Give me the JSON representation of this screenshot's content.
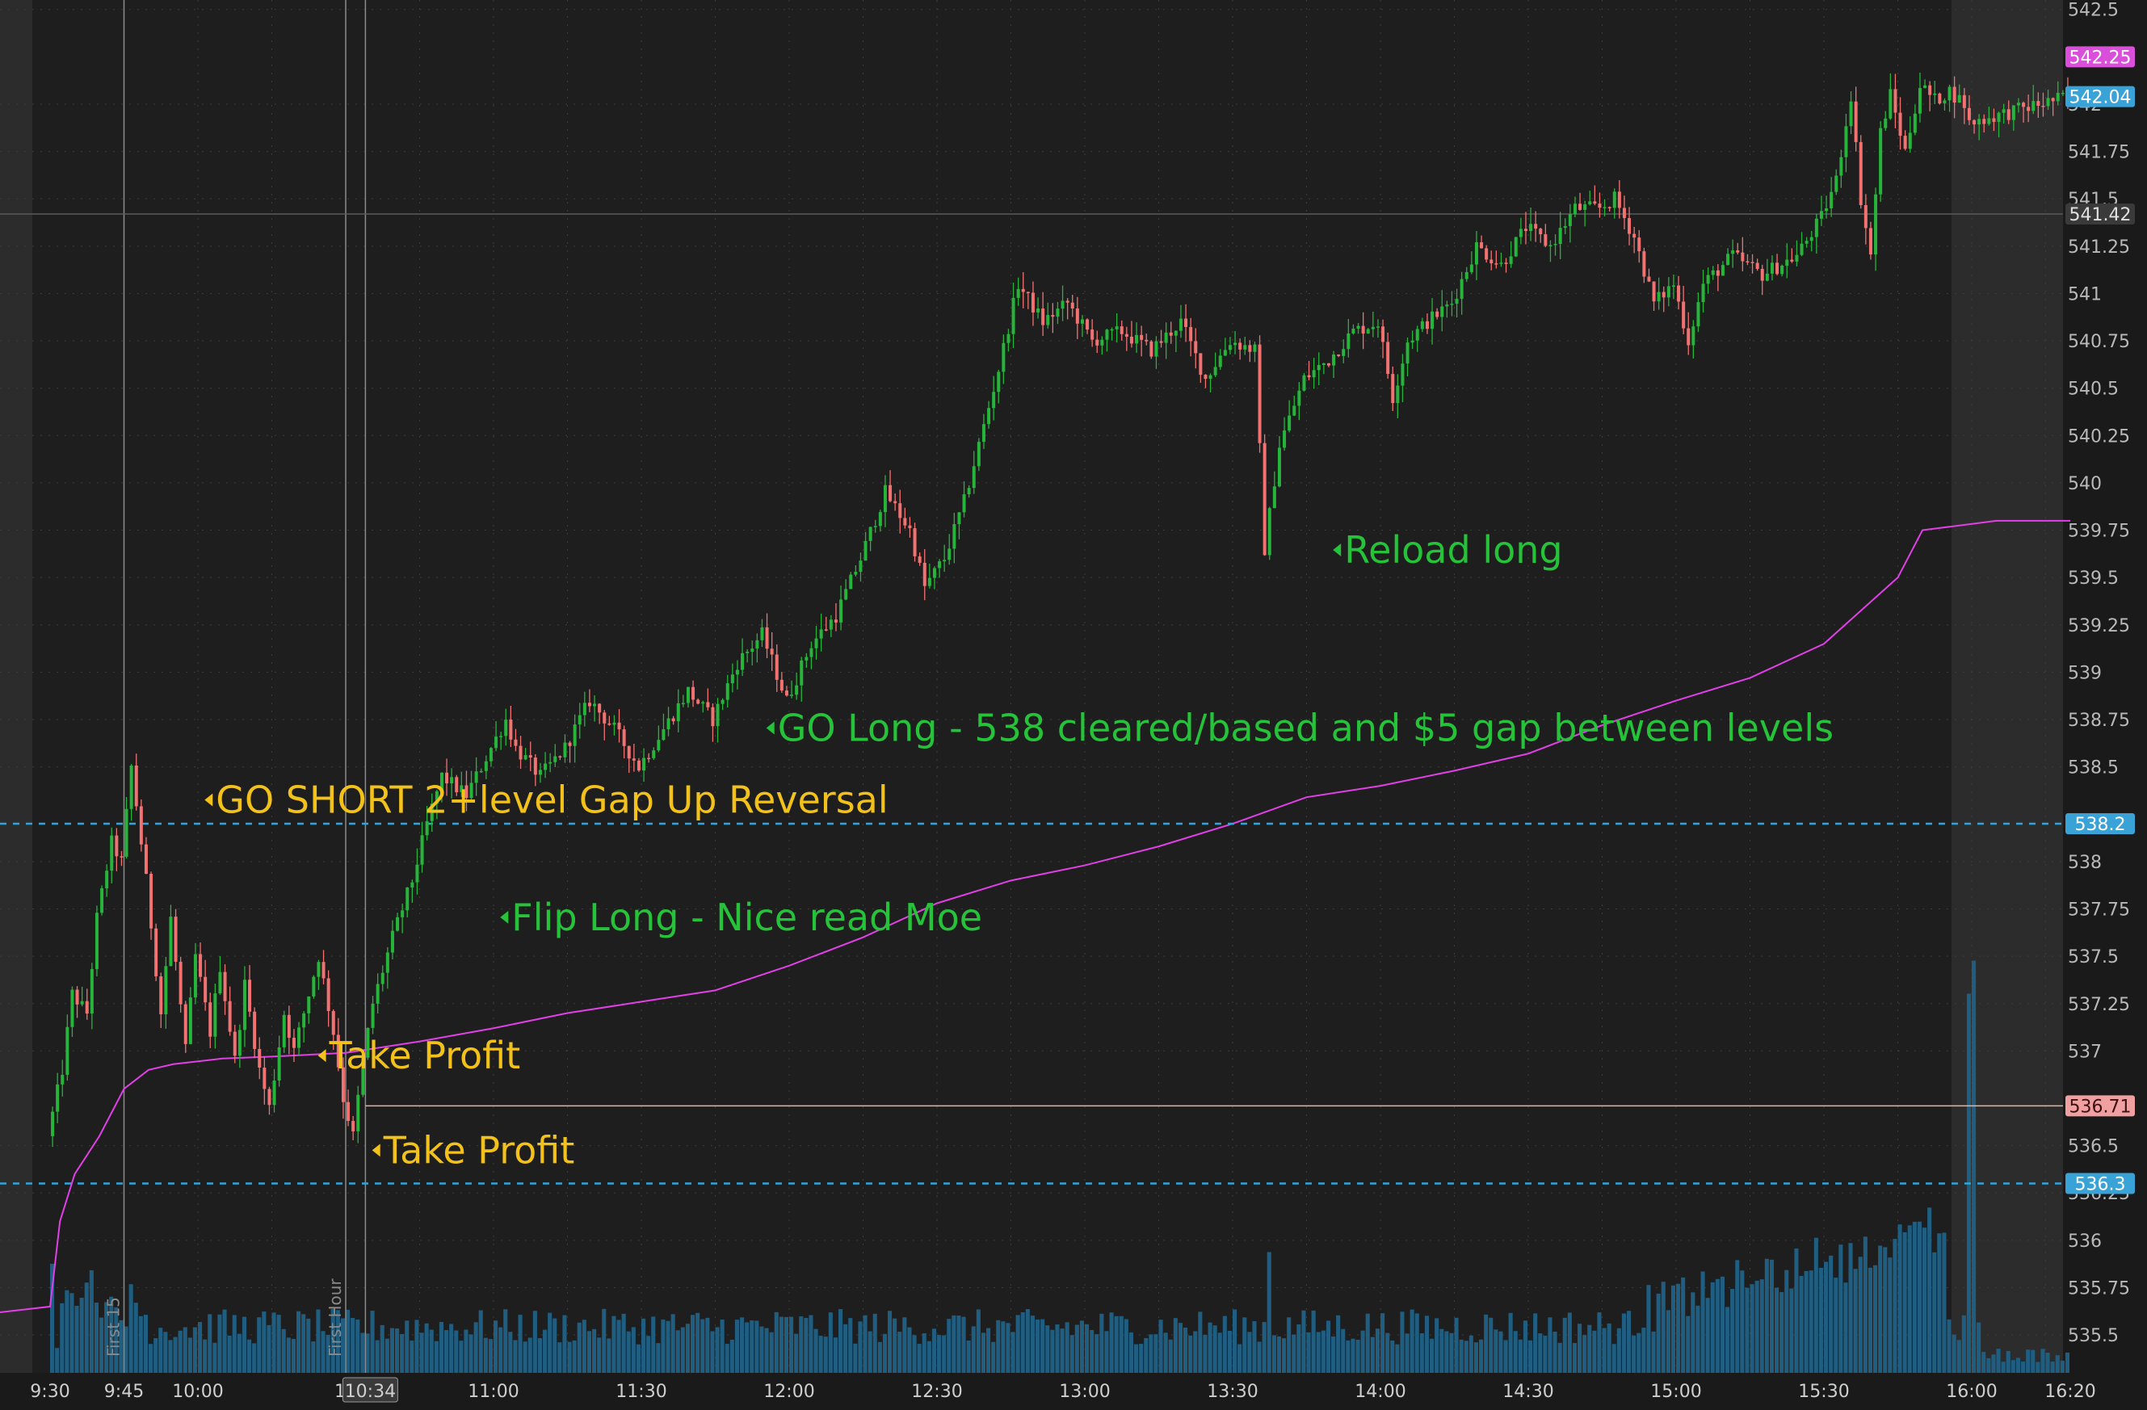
{
  "chart_data": {
    "type": "candlestick",
    "y_axis": {
      "range": [
        535.3,
        542.55
      ],
      "ticks": [
        "542.5",
        "542",
        "541.75",
        "541.5",
        "541.25",
        "541",
        "540.75",
        "540.5",
        "540.25",
        "540",
        "539.75",
        "539.5",
        "539.25",
        "539",
        "538.75",
        "538.5",
        "538",
        "537.75",
        "537.5",
        "537.25",
        "537",
        "536.5",
        "536.25",
        "536",
        "535.75",
        "535.5"
      ]
    },
    "x_axis": {
      "session_range": [
        "9:30",
        "16:20"
      ],
      "ticks": [
        "9:30",
        "9:45",
        "10:00",
        "10",
        "11:00",
        "11:30",
        "12:00",
        "12:30",
        "13:00",
        "13:30",
        "14:00",
        "14:30",
        "15:00",
        "15:30",
        "16:00",
        "16:20"
      ],
      "crosshair_label": "10:34"
    },
    "price_path": [
      [
        "9:30",
        536.55
      ],
      [
        "9:33",
        536.9
      ],
      [
        "9:35",
        537.3
      ],
      [
        "9:38",
        537.2
      ],
      [
        "9:40",
        537.7
      ],
      [
        "9:43",
        538.1
      ],
      [
        "9:45",
        538.0
      ],
      [
        "9:47",
        538.5
      ],
      [
        "9:50",
        537.9
      ],
      [
        "9:53",
        537.2
      ],
      [
        "9:55",
        537.7
      ],
      [
        "9:58",
        537.0
      ],
      [
        "10:00",
        537.5
      ],
      [
        "10:03",
        537.1
      ],
      [
        "10:05",
        537.45
      ],
      [
        "10:08",
        536.95
      ],
      [
        "10:10",
        537.35
      ],
      [
        "10:13",
        536.9
      ],
      [
        "10:15",
        536.7
      ],
      [
        "10:18",
        537.2
      ],
      [
        "10:20",
        537.0
      ],
      [
        "10:23",
        537.3
      ],
      [
        "10:25",
        537.5
      ],
      [
        "10:28",
        537.1
      ],
      [
        "10:30",
        536.75
      ],
      [
        "10:32",
        536.55
      ],
      [
        "10:34",
        536.95
      ],
      [
        "10:36",
        537.25
      ],
      [
        "10:40",
        537.6
      ],
      [
        "10:44",
        537.9
      ],
      [
        "10:47",
        538.2
      ],
      [
        "10:50",
        538.45
      ],
      [
        "10:55",
        538.35
      ],
      [
        "11:00",
        538.6
      ],
      [
        "11:03",
        538.75
      ],
      [
        "11:05",
        538.6
      ],
      [
        "11:10",
        538.45
      ],
      [
        "11:15",
        538.6
      ],
      [
        "11:20",
        538.85
      ],
      [
        "11:25",
        538.7
      ],
      [
        "11:30",
        538.5
      ],
      [
        "11:35",
        538.7
      ],
      [
        "11:40",
        538.9
      ],
      [
        "11:45",
        538.75
      ],
      [
        "11:50",
        539.05
      ],
      [
        "11:55",
        539.2
      ],
      [
        "12:00",
        538.85
      ],
      [
        "12:05",
        539.15
      ],
      [
        "12:10",
        539.3
      ],
      [
        "12:15",
        539.6
      ],
      [
        "12:20",
        539.95
      ],
      [
        "12:25",
        539.75
      ],
      [
        "12:28",
        539.45
      ],
      [
        "12:32",
        539.6
      ],
      [
        "12:36",
        539.9
      ],
      [
        "12:40",
        540.3
      ],
      [
        "12:43",
        540.6
      ],
      [
        "12:47",
        541.05
      ],
      [
        "12:52",
        540.85
      ],
      [
        "12:57",
        540.95
      ],
      [
        "13:02",
        540.75
      ],
      [
        "13:08",
        540.8
      ],
      [
        "13:14",
        540.7
      ],
      [
        "13:20",
        540.85
      ],
      [
        "13:25",
        540.55
      ],
      [
        "13:30",
        540.75
      ],
      [
        "13:35",
        540.7
      ],
      [
        "13:37",
        539.65
      ],
      [
        "13:40",
        540.2
      ],
      [
        "13:45",
        540.55
      ],
      [
        "13:50",
        540.65
      ],
      [
        "13:55",
        540.8
      ],
      [
        "14:00",
        540.85
      ],
      [
        "14:03",
        540.45
      ],
      [
        "14:06",
        540.75
      ],
      [
        "14:10",
        540.85
      ],
      [
        "14:15",
        540.95
      ],
      [
        "14:20",
        541.25
      ],
      [
        "14:25",
        541.15
      ],
      [
        "14:30",
        541.35
      ],
      [
        "14:35",
        541.25
      ],
      [
        "14:40",
        541.45
      ],
      [
        "14:45",
        541.45
      ],
      [
        "14:48",
        541.5
      ],
      [
        "14:52",
        541.3
      ],
      [
        "14:56",
        540.95
      ],
      [
        "15:00",
        541.05
      ],
      [
        "15:03",
        540.75
      ],
      [
        "15:06",
        541.05
      ],
      [
        "15:12",
        541.2
      ],
      [
        "15:18",
        541.1
      ],
      [
        "15:25",
        541.2
      ],
      [
        "15:30",
        541.4
      ],
      [
        "15:33",
        541.6
      ],
      [
        "15:36",
        542.05
      ],
      [
        "15:38",
        541.5
      ],
      [
        "15:40",
        541.2
      ],
      [
        "15:42",
        541.85
      ],
      [
        "15:44",
        542.05
      ],
      [
        "15:47",
        541.75
      ],
      [
        "15:50",
        542.1
      ],
      [
        "15:53",
        542.02
      ],
      [
        "15:56",
        542.07
      ],
      [
        "15:59",
        542.0
      ],
      [
        "16:00",
        541.9
      ],
      [
        "16:20",
        542.04
      ]
    ],
    "vwap": [
      [
        "9:30",
        535.65
      ],
      [
        "9:32",
        536.1
      ],
      [
        "9:35",
        536.35
      ],
      [
        "9:40",
        536.55
      ],
      [
        "9:45",
        536.8
      ],
      [
        "9:50",
        536.9
      ],
      [
        "9:55",
        536.93
      ],
      [
        "10:05",
        536.96
      ],
      [
        "10:15",
        536.97
      ],
      [
        "10:30",
        536.99
      ],
      [
        "10:45",
        537.05
      ],
      [
        "11:00",
        537.12
      ],
      [
        "11:15",
        537.2
      ],
      [
        "11:30",
        537.26
      ],
      [
        "11:45",
        537.32
      ],
      [
        "12:00",
        537.45
      ],
      [
        "12:15",
        537.6
      ],
      [
        "12:30",
        537.78
      ],
      [
        "12:45",
        537.9
      ],
      [
        "13:00",
        537.98
      ],
      [
        "13:15",
        538.08
      ],
      [
        "13:30",
        538.2
      ],
      [
        "13:45",
        538.34
      ],
      [
        "14:00",
        538.4
      ],
      [
        "14:15",
        538.48
      ],
      [
        "14:30",
        538.57
      ],
      [
        "14:45",
        538.72
      ],
      [
        "15:00",
        538.85
      ],
      [
        "15:15",
        538.97
      ],
      [
        "15:30",
        539.15
      ],
      [
        "15:45",
        539.5
      ],
      [
        "15:50",
        539.75
      ],
      [
        "16:05",
        539.8
      ],
      [
        "16:20",
        539.8
      ]
    ],
    "volume_profile": {
      "open_spike": 0.35,
      "midday_spike_13:37": 0.55,
      "close_spike": 0.92,
      "close_peak": 1.0
    },
    "price_badges": [
      {
        "label": "542.25",
        "value": 542.25,
        "bg": "#d94fd9",
        "fg": "#ffffff"
      },
      {
        "label": "542.04",
        "value": 542.04,
        "bg": "#39a3d8",
        "fg": "#ffffff"
      },
      {
        "label": "541.42",
        "value": 541.42,
        "bg": "#3a3a3a",
        "fg": "#e0e0e0"
      },
      {
        "label": "538.2",
        "value": 538.2,
        "bg": "#39a3d8",
        "fg": "#ffffff"
      },
      {
        "label": "536.71",
        "value": 536.71,
        "bg": "#f0a0a0",
        "fg": "#3a1010"
      },
      {
        "label": "536.3",
        "value": 536.3,
        "bg": "#39a3d8",
        "fg": "#ffffff"
      }
    ],
    "levels": [
      {
        "value": 538.2,
        "style": "dashed",
        "color": "#2ea8dc"
      },
      {
        "value": 536.3,
        "style": "dashed",
        "color": "#2ea8dc"
      },
      {
        "value": 536.71,
        "style": "solid",
        "color": "#e8b4a0"
      },
      {
        "value": 541.42,
        "style": "solid",
        "color": "#5a5a5a"
      }
    ],
    "vertical_markers": [
      {
        "time": "9:45",
        "label": "First 15"
      },
      {
        "time": "10:30",
        "label": "First Hour"
      },
      {
        "time": "10:34",
        "label": ""
      }
    ],
    "annotations": [
      {
        "text": "GO SHORT 2+level Gap Up Reversal",
        "time": "10:03",
        "price": 538.3,
        "color": "#f2c11b"
      },
      {
        "text": "Flip Long - Nice read Moe",
        "time": "11:03",
        "price": 537.68,
        "color": "#26c23a"
      },
      {
        "text": "Take Profit",
        "time": "10:26",
        "price": 536.95,
        "color": "#f2c11b"
      },
      {
        "text": "Take Profit",
        "time": "10:37",
        "price": 536.45,
        "color": "#f2c11b"
      },
      {
        "text": "GO Long - 538 cleared/based and $5 gap between levels",
        "time": "11:57",
        "price": 538.68,
        "color": "#26c23a"
      },
      {
        "text": "Reload long",
        "time": "13:52",
        "price": 539.62,
        "color": "#26c23a"
      }
    ],
    "colors": {
      "background": "#1e1e1e",
      "up": "#26b43a",
      "down": "#f27272",
      "vwap": "#e040e6",
      "volume": "#1f5e80",
      "extended_hours": "#2c2c2c",
      "grid": "#3c3c3c"
    }
  }
}
